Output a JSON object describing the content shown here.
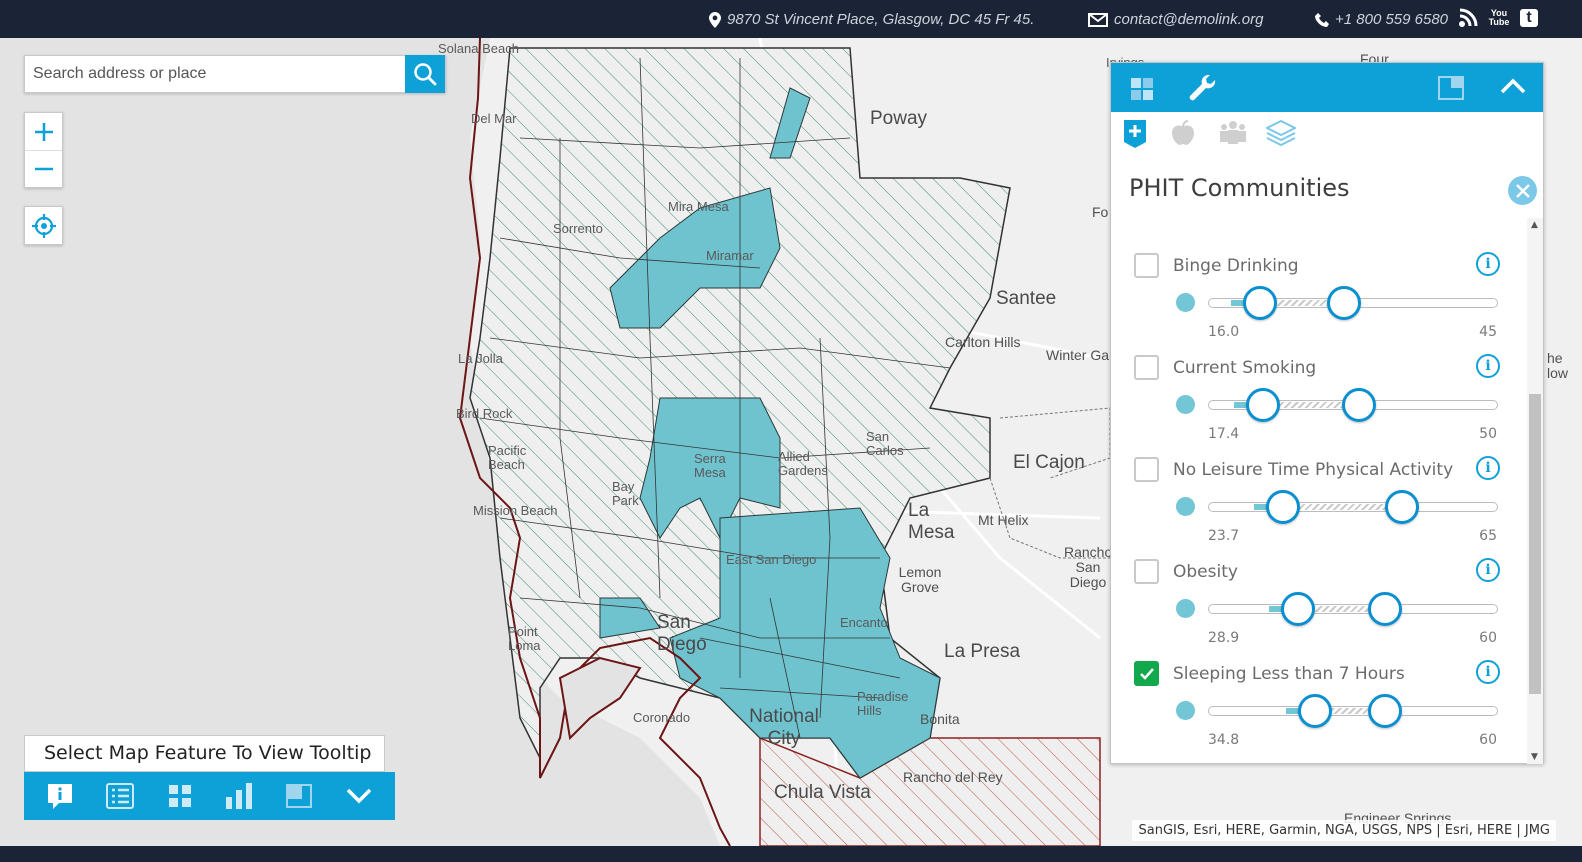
{
  "topbar": {
    "address": "9870 St Vincent Place, Glasgow, DC 45 Fr 45.",
    "email": "contact@demolink.org",
    "phone": "+1 800 559 6580",
    "social_icons": [
      "rss-icon",
      "youtube-icon",
      "twitter-icon"
    ],
    "youtube_text": "You Tube"
  },
  "search": {
    "placeholder": "Search address or place"
  },
  "map": {
    "labels": {
      "solana_beach": "Solana Beach",
      "del_mar": "Del Mar",
      "poway": "Poway",
      "mira_mesa": "Mira Mesa",
      "sorrento": "Sorrento",
      "miramar": "Miramar",
      "santee": "Santee",
      "carlton_hills": "Carlton Hills",
      "winter_ga": "Winter Ga",
      "la_jolla": "La Jolla",
      "bird_rock": "Bird Rock",
      "pacific_beach": "Pacific Beach",
      "mission_beach": "Mission Beach",
      "bay_park": "Bay Park",
      "serra_mesa": "Serra Mesa",
      "allied_gardens": "Allied Gardens",
      "san_carlos": "San Carlos",
      "el_cajon": "El Cajon",
      "la_mesa": "La Mesa",
      "mt_helix": "Mt Helix",
      "rancho_san_diego": "Rancho San Diego",
      "east_san_diego": "East San Diego",
      "lemon_grove": "Lemon Grove",
      "point_loma": "Point Loma",
      "san_diego": "San Diego",
      "encanto": "Encanto",
      "la_presa": "La Presa",
      "coronado": "Coronado",
      "national_city": "National City",
      "paradise_hills": "Paradise Hills",
      "bonita": "Bonita",
      "chula_vista": "Chula Vista",
      "rancho_del_rey": "Rancho del Rey",
      "engineer_springs": "Engineer Springs",
      "four": "Four",
      "irvings": "Irvings",
      "fo": "Fo",
      "the_willows": "he low"
    },
    "attribution": "SanGIS, Esri, HERE, Garmin, NGA, USGS, NPS | Esri, HERE | JMG"
  },
  "tooltip_prompt": "Select Map Feature To View Tooltip",
  "toolstrip": [
    "info-icon",
    "list-icon",
    "grid-icon",
    "bar-chart-icon",
    "window-icon",
    "chevron-down-icon"
  ],
  "panel": {
    "header_tabs": [
      "grid-tab-icon",
      "wrench-icon"
    ],
    "sub_tabs": [
      "health-plus-icon",
      "apple-icon",
      "people-icon",
      "layers-icon"
    ],
    "title": "PHIT Communities",
    "accent": "#0ea1d8",
    "fill_color": "#72c6d6",
    "filters": [
      {
        "label": "Binge Drinking",
        "checked": false,
        "min": "16.0",
        "max": "45",
        "low": 0.18,
        "high": 0.47
      },
      {
        "label": "Current Smoking",
        "checked": false,
        "min": "17.4",
        "max": "50",
        "low": 0.19,
        "high": 0.52
      },
      {
        "label": "No Leisure Time Physical Activity",
        "checked": false,
        "min": "23.7",
        "max": "65",
        "low": 0.26,
        "high": 0.67
      },
      {
        "label": "Obesity",
        "checked": false,
        "min": "28.9",
        "max": "60",
        "low": 0.31,
        "high": 0.61
      },
      {
        "label": "Sleeping Less than 7 Hours",
        "checked": true,
        "min": "34.8",
        "max": "60",
        "low": 0.37,
        "high": 0.61
      }
    ]
  }
}
